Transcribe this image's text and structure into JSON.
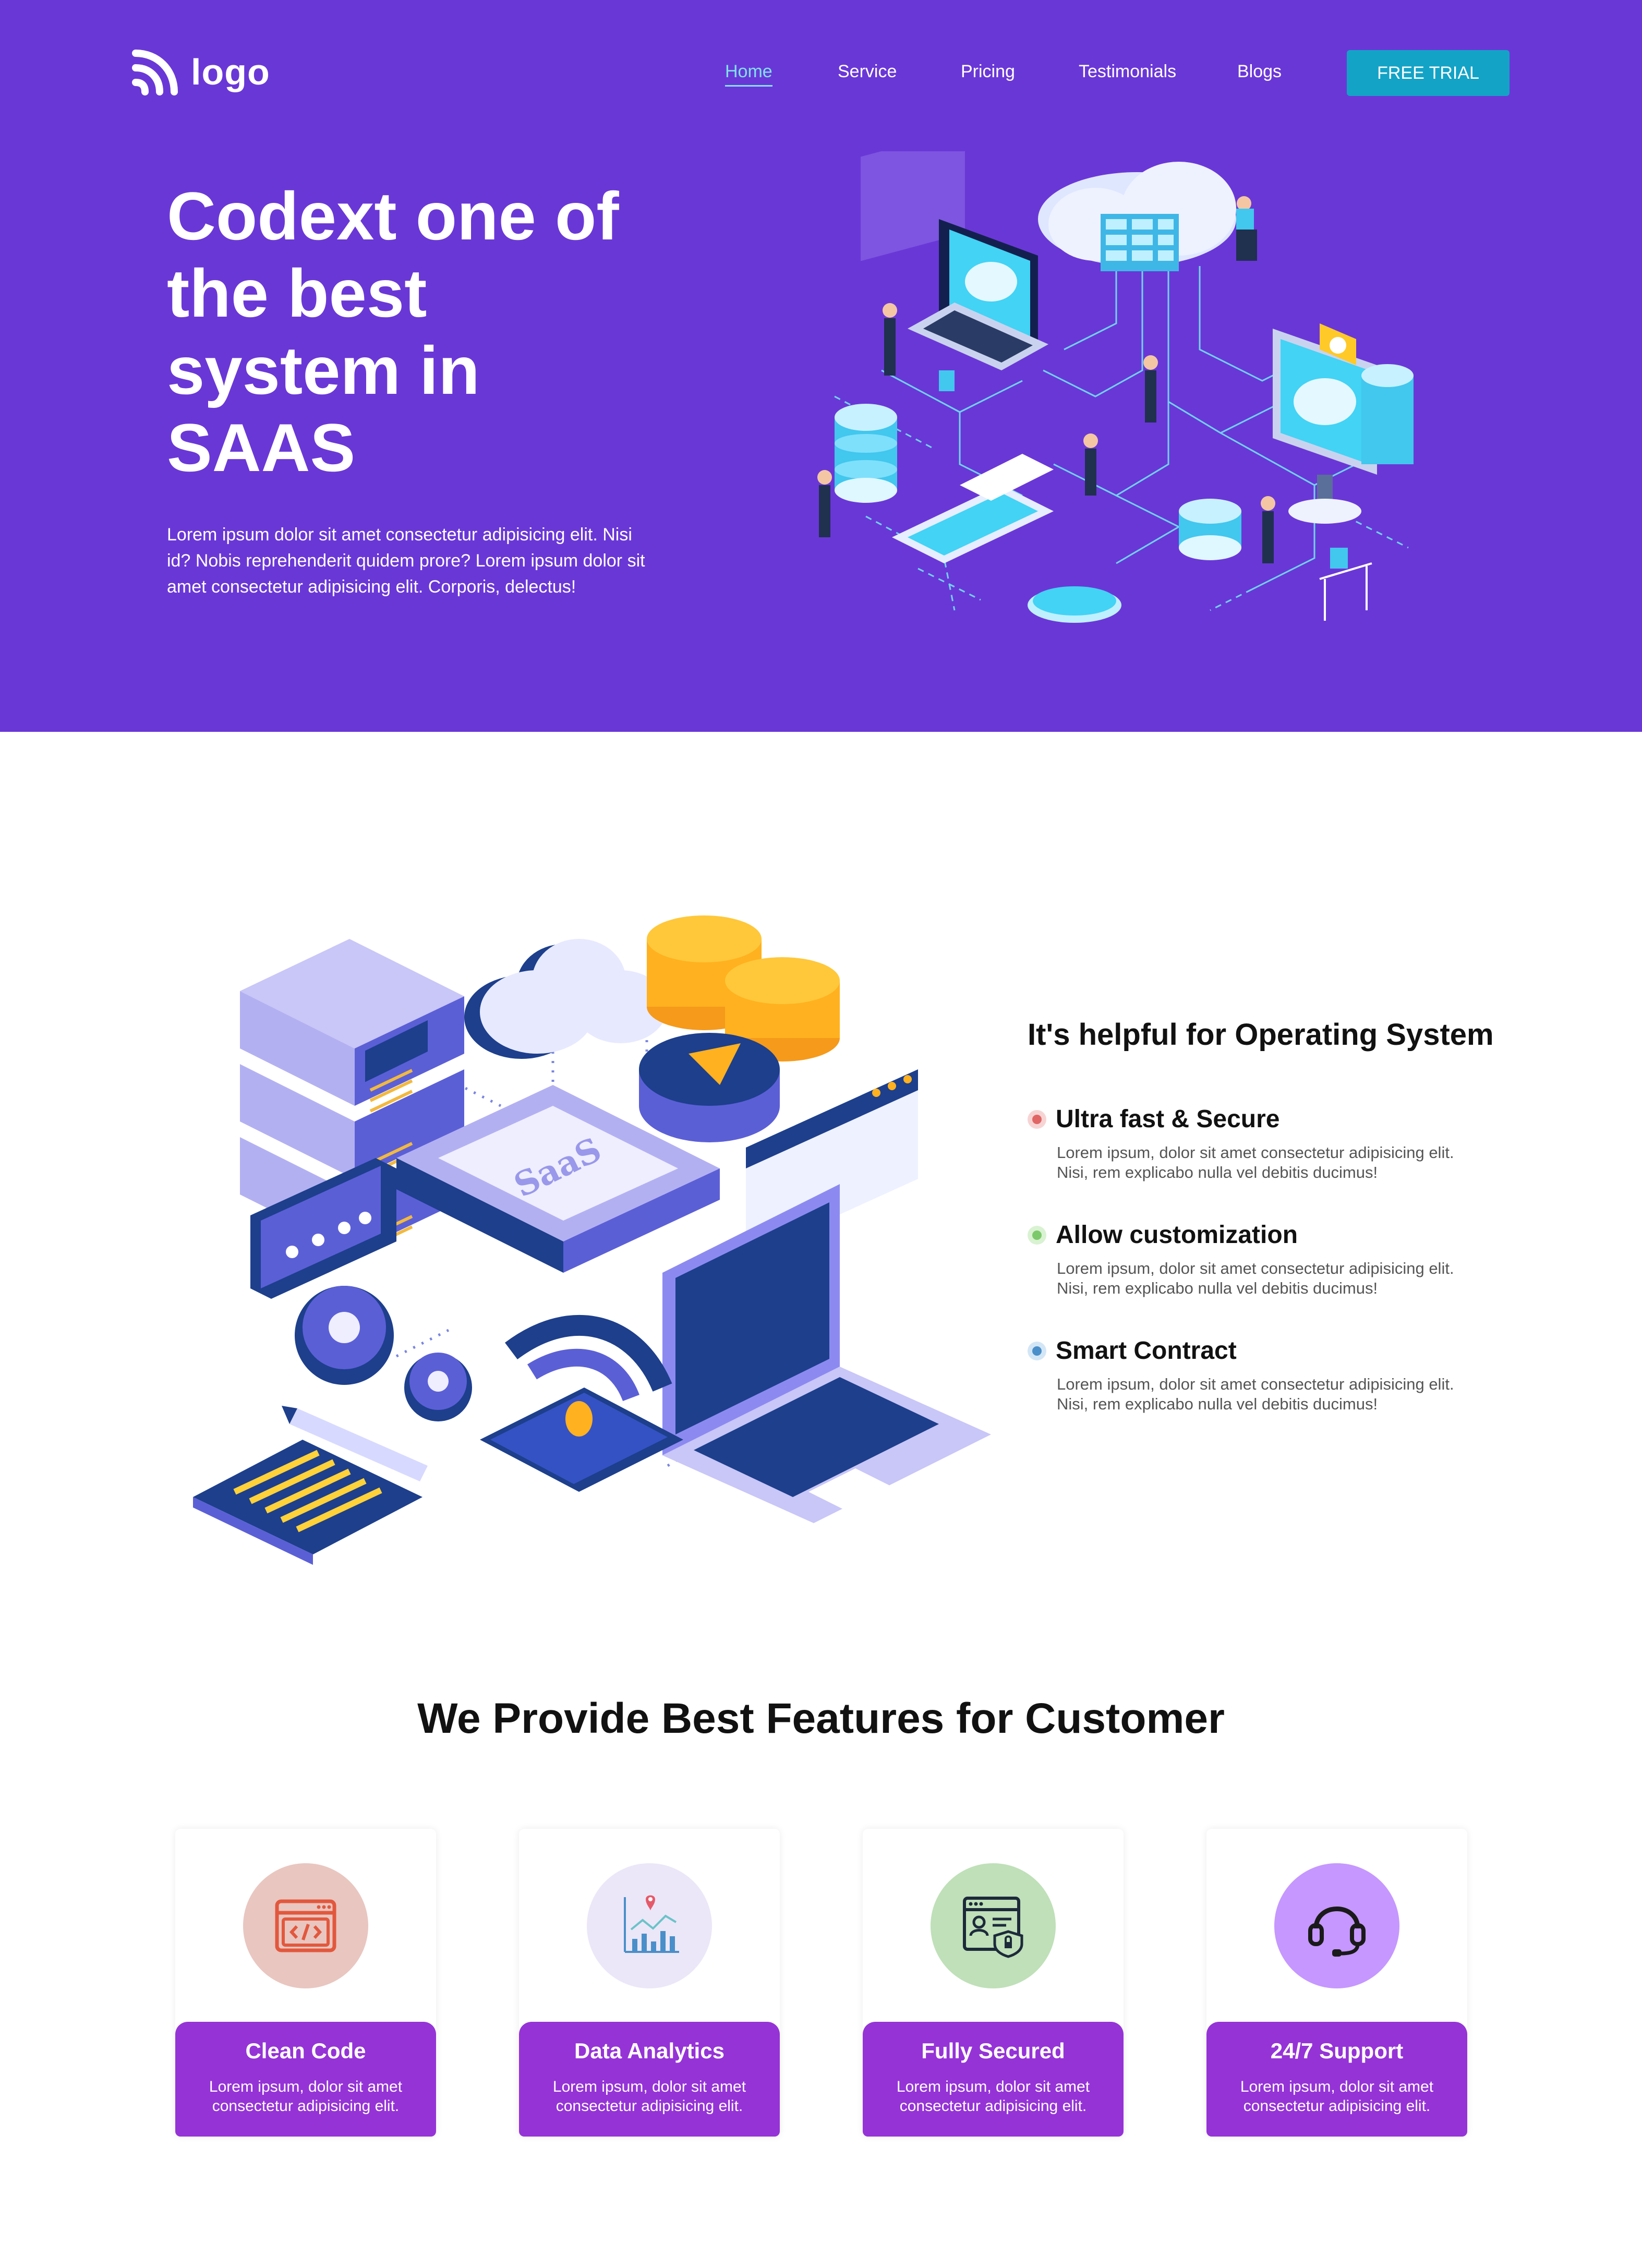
{
  "header": {
    "logo_text": "logo",
    "logo_icon": "wifi-logo-icon",
    "nav": [
      {
        "label": "Home",
        "active": true
      },
      {
        "label": "Service"
      },
      {
        "label": "Pricing"
      },
      {
        "label": "Testimonials"
      },
      {
        "label": "Blogs"
      }
    ],
    "cta_label": "FREE TRIAL"
  },
  "hero": {
    "title": "Codext one of the best system in SAAS",
    "text": "Lorem ipsum dolor sit amet consectetur adipisicing elit. Nisi id? Nobis reprehenderit quidem prore? Lorem ipsum dolor sit amet consectetur adipisicing elit. Corporis, delectus!",
    "illustration": "cloud-network-illustration"
  },
  "about": {
    "heading": "It's helpful for Operating System",
    "illustration": "saas-isometric-illustration",
    "artwork_text": "SaaS",
    "features": [
      {
        "title": "Ultra fast & Secure",
        "text": "Lorem ipsum, dolor sit amet consectetur adipisicing elit. Nisi, rem explicabo nulla vel debitis ducimus!",
        "bullet_color": "#e06666"
      },
      {
        "title": "Allow customization",
        "text": "Lorem ipsum, dolor sit amet consectetur adipisicing elit. Nisi, rem explicabo nulla vel debitis ducimus!",
        "bullet_color": "#7cc96b"
      },
      {
        "title": "Smart Contract",
        "text": "Lorem ipsum, dolor sit amet consectetur adipisicing elit. Nisi, rem explicabo nulla vel debitis ducimus!",
        "bullet_color": "#4a8fc9"
      }
    ]
  },
  "features_section": {
    "heading": "We Provide Best Features for Customer",
    "cards": [
      {
        "title": "Clean Code",
        "text": "Lorem ipsum, dolor sit amet consectetur adipisicing elit.",
        "icon": "code-window-icon",
        "icon_bg": "#e9c6c0"
      },
      {
        "title": "Data Analytics",
        "text": "Lorem ipsum, dolor sit amet consectetur adipisicing elit.",
        "icon": "analytics-chart-icon",
        "icon_bg": "#ebe7f8"
      },
      {
        "title": "Fully Secured",
        "text": "Lorem ipsum, dolor sit amet consectetur adipisicing elit.",
        "icon": "secure-profile-icon",
        "icon_bg": "#bfe0b8"
      },
      {
        "title": "24/7 Support",
        "text": "Lorem ipsum, dolor sit amet consectetur adipisicing elit.",
        "icon": "headset-icon",
        "icon_bg": "#c597ff"
      }
    ]
  },
  "colors": {
    "hero_bg": "#6a37d7",
    "nav_active": "#7fe3f2",
    "cta_bg": "#13a3c7",
    "card_accent": "#9533d7"
  }
}
